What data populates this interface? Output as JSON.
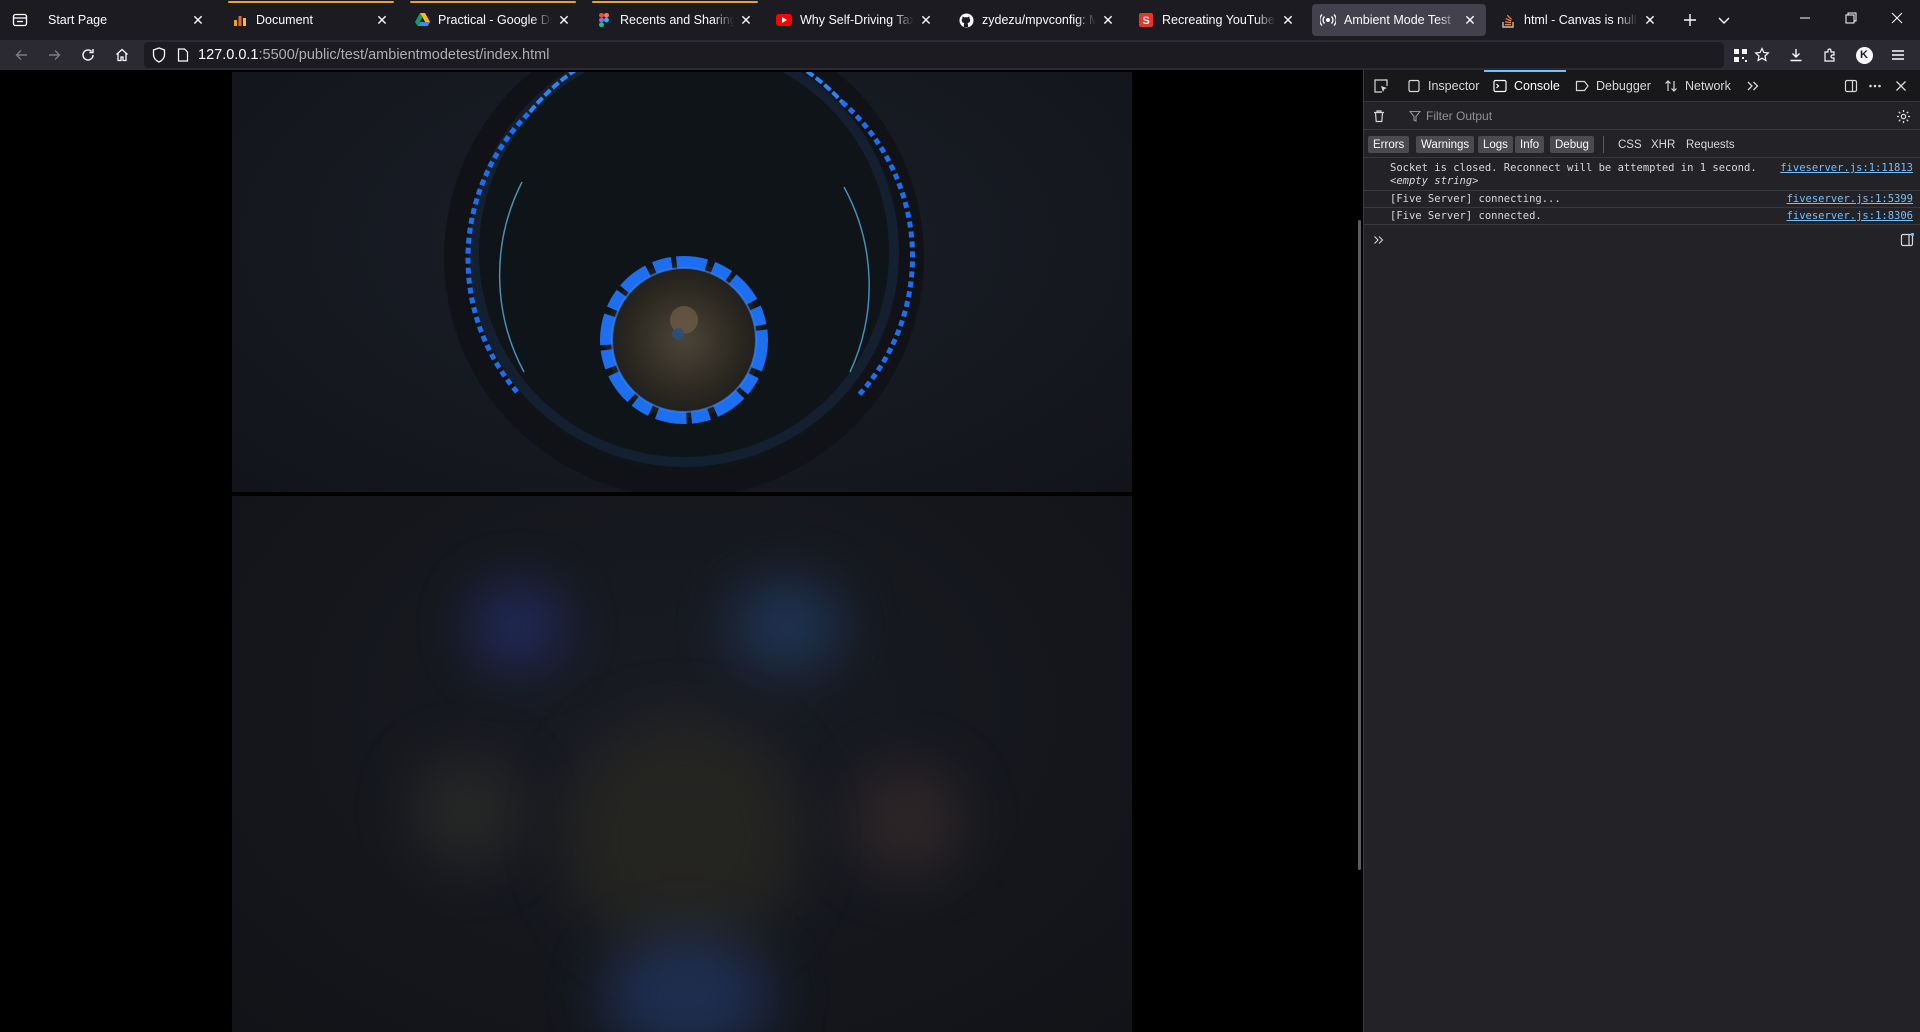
{
  "browser": {
    "tabs": [
      {
        "title": "Start Page",
        "favicon": "blank-icon",
        "active": false,
        "playing_line": false
      },
      {
        "title": "Document",
        "favicon": "bar-chart-icon",
        "active": false,
        "playing_line": true
      },
      {
        "title": "Practical - Google Drive",
        "favicon": "google-drive-icon",
        "active": false,
        "playing_line": true
      },
      {
        "title": "Recents and Sharing – Figma",
        "favicon": "figma-icon",
        "active": false,
        "playing_line": true
      },
      {
        "title": "Why Self-Driving Taxis are",
        "favicon": "youtube-icon",
        "active": false,
        "playing_line": false
      },
      {
        "title": "zydezu/mpvconfig: My",
        "favicon": "github-icon",
        "active": false,
        "playing_line": false
      },
      {
        "title": "Recreating YouTube's Ambient",
        "favicon": "s-logo-icon",
        "active": false,
        "playing_line": false
      },
      {
        "title": "Ambient Mode Test",
        "favicon": "broadcast-icon",
        "active": true,
        "playing_line": false
      },
      {
        "title": "html - Canvas is null error",
        "favicon": "stackoverflow-icon",
        "active": false,
        "playing_line": false
      }
    ],
    "url_host": "127.0.0.1",
    "url_rest": ":5500/public/test/ambientmodetest/index.html",
    "profile_initial": "K"
  },
  "devtools": {
    "tabs": [
      {
        "label": "Inspector",
        "icon": "inspector-icon"
      },
      {
        "label": "Console",
        "icon": "console-icon",
        "active": true
      },
      {
        "label": "Debugger",
        "icon": "debugger-icon"
      },
      {
        "label": "Network",
        "icon": "network-icon"
      }
    ],
    "filter_placeholder": "Filter Output",
    "levels": [
      {
        "label": "Errors",
        "on": true
      },
      {
        "label": "Warnings",
        "on": true
      },
      {
        "label": "Logs",
        "on": true
      },
      {
        "label": "Info",
        "on": true
      },
      {
        "label": "Debug",
        "on": true
      }
    ],
    "request_filters": [
      "CSS",
      "XHR",
      "Requests"
    ],
    "messages": [
      {
        "text": "Socket is closed. Reconnect will be attempted in 1 second.",
        "extra": "<empty string>",
        "source": "fiveserver.js:1:11813"
      },
      {
        "text": "[Five Server] connecting...",
        "extra": "",
        "source": "fiveserver.js:1:5399"
      },
      {
        "text": "[Five Server] connected.",
        "extra": "",
        "source": "fiveserver.js:1:8306"
      }
    ]
  },
  "colors": {
    "accent_tab_line": "#f0a030",
    "devtools_accent": "#75bfff",
    "ring_blue": "#1e6ff0"
  }
}
